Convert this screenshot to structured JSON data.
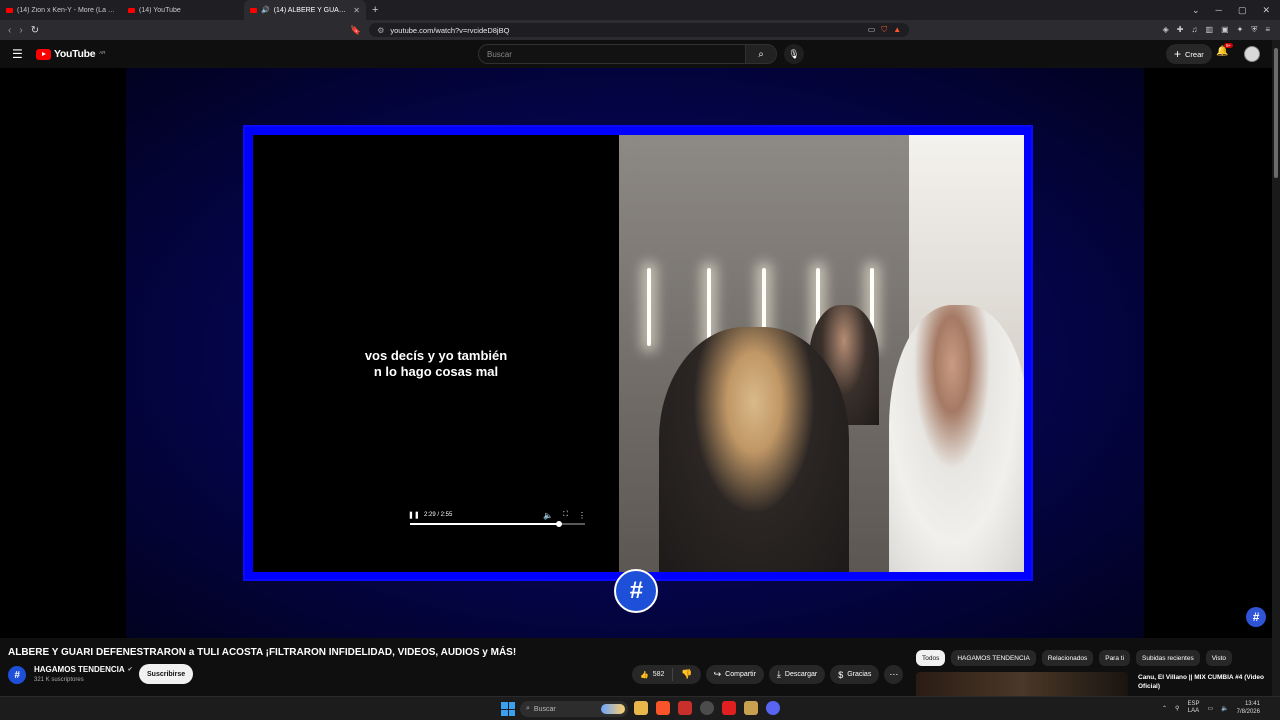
{
  "browser": {
    "tabs": [
      {
        "title": "(14) Zion x Ken-Y - More (La Formula...",
        "active": false
      },
      {
        "title": "(14) YouTube",
        "active": false
      },
      {
        "title": "(14) ALBERE Y GUARI DEFENES...",
        "active": true
      }
    ],
    "url": "youtube.com/watch?v=rvcideD8jBQ"
  },
  "masthead": {
    "logo_text": "YouTube",
    "country": "AR",
    "search_placeholder": "Buscar",
    "create_label": "Crear",
    "notifications": "9+"
  },
  "player": {
    "caption_line1": "vos decís y yo también",
    "caption_line2": "n lo hago cosas mal",
    "time": "2:29 / 2:55",
    "progress": 0.85,
    "logo_glyph": "#",
    "watermark_glyph": "#"
  },
  "video": {
    "title": "ALBERE Y GUARI DEFENESTRARON a TULI ACOSTA ¡FILTRARON INFIDELIDAD, VIDEOS, AUDIOS y MÁS!",
    "channel": "HAGAMOS TENDENCIA",
    "subscribers": "321 K suscriptores",
    "subscribe_label": "Suscribirse",
    "likes": "582",
    "share_label": "Compartir",
    "download_label": "Descargar",
    "thanks_label": "Gracias"
  },
  "chips": [
    "Todos",
    "HAGAMOS TENDENCIA",
    "Relacionados",
    "Para ti",
    "Subidas recientes",
    "Visto"
  ],
  "related": {
    "title": "Canu, El Villano || MIX CUMBIA #4 (Video Oficial)"
  },
  "taskbar": {
    "search_placeholder": "Buscar",
    "lang": "ESP",
    "region": "LAA",
    "time": "13:41",
    "date": "7/8/2026"
  },
  "colors": {
    "frame_blue": "#0000ff",
    "brand_red": "#ff0000",
    "channel_blue": "#1d4fd8"
  }
}
